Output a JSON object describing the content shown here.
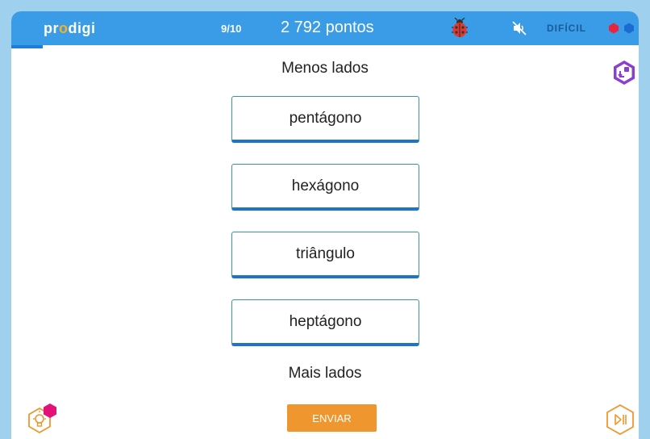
{
  "header": {
    "logo": {
      "pre": "pr",
      "accent": "o",
      "post": "digi"
    },
    "counter": "9/10",
    "progress_fraction": 0.9,
    "score": "2 792 pontos",
    "difficulty": "DIFÍCIL"
  },
  "question": {
    "top_label": "Menos lados",
    "bottom_label": "Mais lados",
    "options": [
      "pentágono",
      "hexágono",
      "triângulo",
      "heptágono"
    ]
  },
  "footer": {
    "submit_label": "ENVIAR"
  },
  "icons": {
    "ladybug": "ladybug-icon",
    "mute": "mute-icon",
    "hex_tool": "hexagon-tool-icon",
    "hint": "lightbulb-icon",
    "next": "skip-next-icon"
  },
  "colors": {
    "header": "#3a9be6",
    "accent_orange": "#f0962e",
    "option_border": "#2f8ee0",
    "difficulty_red": "#e8253d",
    "difficulty_blue": "#1b6bd1",
    "hex_purple": "#8a3fd1",
    "hint_badge": "#e2127a"
  }
}
